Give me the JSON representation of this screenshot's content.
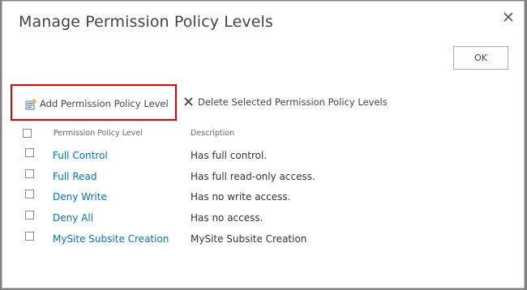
{
  "dialog": {
    "title": "Manage Permission Policy Levels",
    "ok_label": "OK"
  },
  "toolbar": {
    "add_label": "Add Permission Policy Level",
    "delete_label": "Delete Selected Permission Policy Levels"
  },
  "table": {
    "columns": [
      "Permission Policy Level",
      "Description"
    ],
    "rows": [
      {
        "name": "Full Control",
        "description": "Has full control."
      },
      {
        "name": "Full Read",
        "description": "Has full read-only access."
      },
      {
        "name": "Deny Write",
        "description": "Has no write access."
      },
      {
        "name": "Deny All",
        "description": "Has no access."
      },
      {
        "name": "MySite Subsite Creation",
        "description": "MySite Subsite Creation"
      }
    ]
  },
  "colors": {
    "link": "#0072c6",
    "highlight_border": "#e00000"
  },
  "icons": {
    "close": "close-icon",
    "add": "add-policy-icon",
    "delete": "delete-x-icon"
  }
}
